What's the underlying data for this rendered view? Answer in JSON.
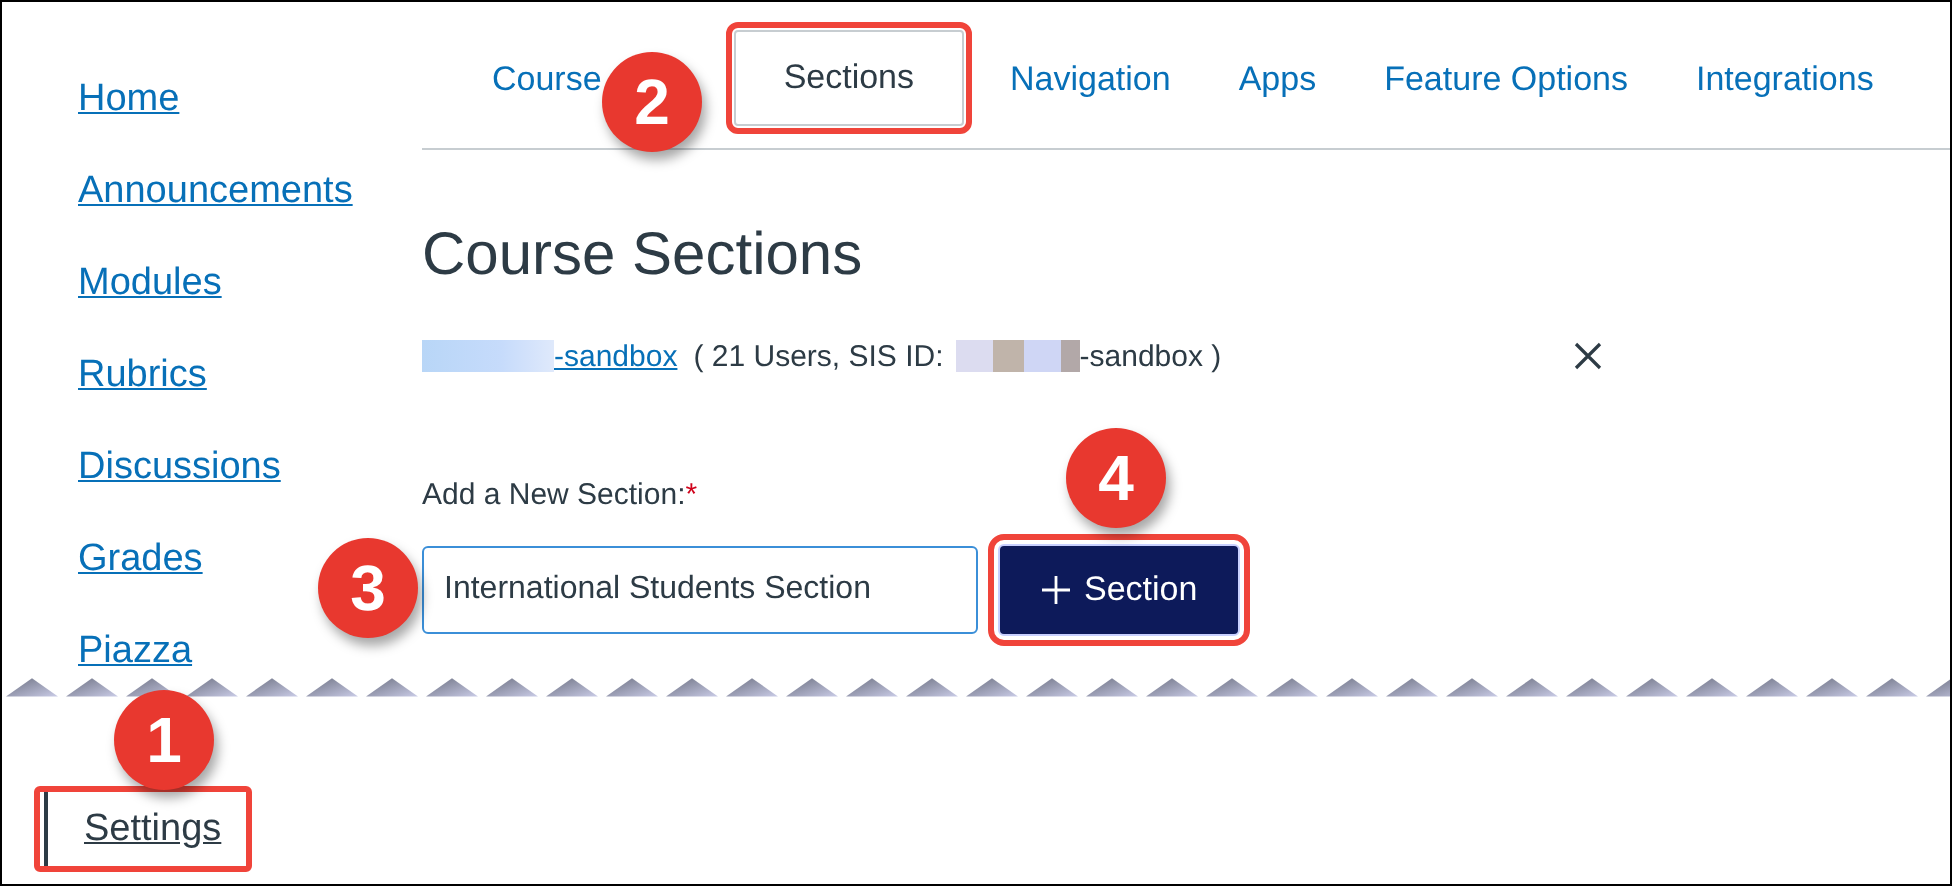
{
  "sidebar": {
    "items": [
      {
        "label": "Home",
        "selected": false
      },
      {
        "label": "Announcements",
        "selected": false
      },
      {
        "label": "Modules",
        "selected": false
      },
      {
        "label": "Rubrics",
        "selected": false
      },
      {
        "label": "Discussions",
        "selected": false
      },
      {
        "label": "Grades",
        "selected": false
      },
      {
        "label": "Piazza",
        "selected": false
      },
      {
        "label": "Settings",
        "selected": true
      }
    ]
  },
  "tabs": [
    {
      "label": "Course",
      "selected": false
    },
    {
      "label": "Sections",
      "selected": true
    },
    {
      "label": "Navigation",
      "selected": false
    },
    {
      "label": "Apps",
      "selected": false
    },
    {
      "label": "Feature Options",
      "selected": false
    },
    {
      "label": "Integrations",
      "selected": false
    }
  ],
  "heading": "Course Sections",
  "section_row": {
    "link": "-sandbox",
    "info_before": "( 21 Users, SIS ID:",
    "info_after": "-sandbox )"
  },
  "new_section": {
    "label": "Add a New Section:",
    "required_mark": "*",
    "value": "International Students Section",
    "button": "Section"
  },
  "callouts": [
    {
      "number": "1"
    },
    {
      "number": "2"
    },
    {
      "number": "3"
    },
    {
      "number": "4"
    }
  ]
}
